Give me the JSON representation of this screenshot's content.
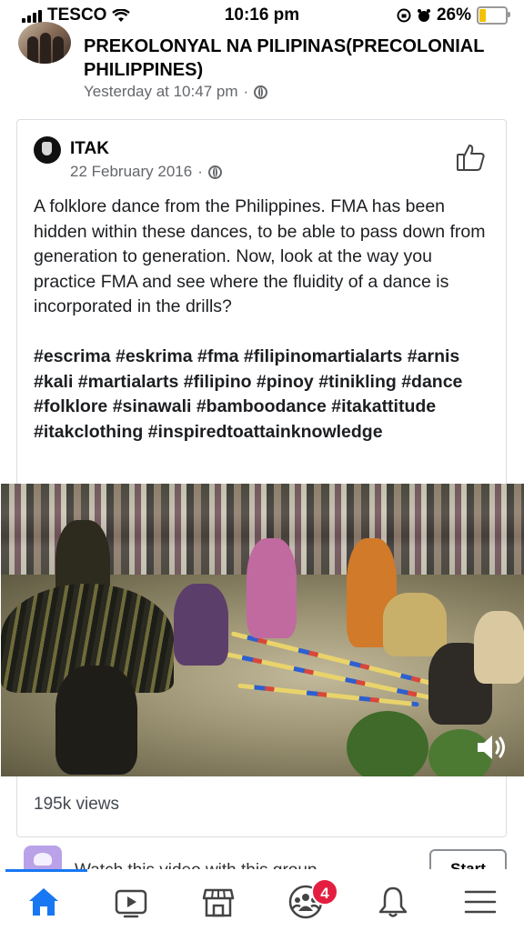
{
  "status_bar": {
    "carrier": "TESCO",
    "time": "10:16 pm",
    "battery_percent": "26%",
    "battery_level": 0.26,
    "icons": [
      "signal-icon",
      "wifi-icon",
      "orientation-lock-icon",
      "alarm-icon",
      "battery-icon"
    ]
  },
  "post": {
    "title": "PREKOLONYAL NA PILIPINAS(PRECOLONIAL PHILIPPINES)",
    "time": "Yesterday at 10:47 pm",
    "separator": "·",
    "privacy_icon": "globe-icon"
  },
  "shared_post": {
    "author": "ITAK",
    "date": "22 February 2016",
    "separator": "·",
    "privacy_icon": "globe-icon",
    "like_icon": "thumbs-up-icon",
    "body": "A folklore dance from the Philippines. FMA has been hidden within these dances, to be able to pass down from generation to generation. Now, look at the way you practice FMA and see where the fluidity of a dance is incorporated in the drills?",
    "hashtags": "#escrima #eskrima #fma #filipinomartialarts #arnis #kali #martialarts #filipino #pinoy #tinikling #dance #folklore #sinawali #bamboodance #itakattitude #itakclothing #inspiredtoattainknowledge",
    "video_icon": "volume-icon",
    "views": "195k views"
  },
  "group_promo": {
    "text": "Watch this video with this group",
    "button_label": "Start"
  },
  "bottom_nav": {
    "items": [
      "home-icon",
      "watch-icon",
      "marketplace-icon",
      "groups-icon",
      "notifications-icon",
      "menu-icon"
    ],
    "active": "home",
    "groups_badge": "4",
    "active_color": "#1877f2"
  }
}
